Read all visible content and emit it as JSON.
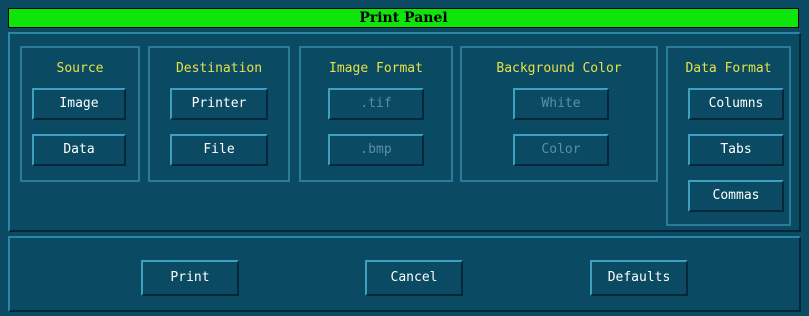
{
  "window": {
    "title": "Print Panel"
  },
  "groups": {
    "source": {
      "title": "Source",
      "buttons": [
        "Image",
        "Data"
      ]
    },
    "destination": {
      "title": "Destination",
      "buttons": [
        "Printer",
        "File"
      ]
    },
    "image_format": {
      "title": "Image Format",
      "buttons": [
        ".tif",
        ".bmp"
      ],
      "enabled": false
    },
    "background_color": {
      "title": "Background Color",
      "buttons": [
        "White",
        "Color"
      ],
      "enabled": false
    },
    "data_format": {
      "title": "Data Format",
      "buttons": [
        "Columns",
        "Tabs",
        "Commas"
      ]
    }
  },
  "actions": {
    "print": "Print",
    "cancel": "Cancel",
    "defaults": "Defaults"
  },
  "colors": {
    "titlebar": "#0ee60b",
    "background": "#0b4a63",
    "group_title": "#e6e04a",
    "button_text": "#ffffff",
    "disabled_text": "#5a8fa3"
  }
}
